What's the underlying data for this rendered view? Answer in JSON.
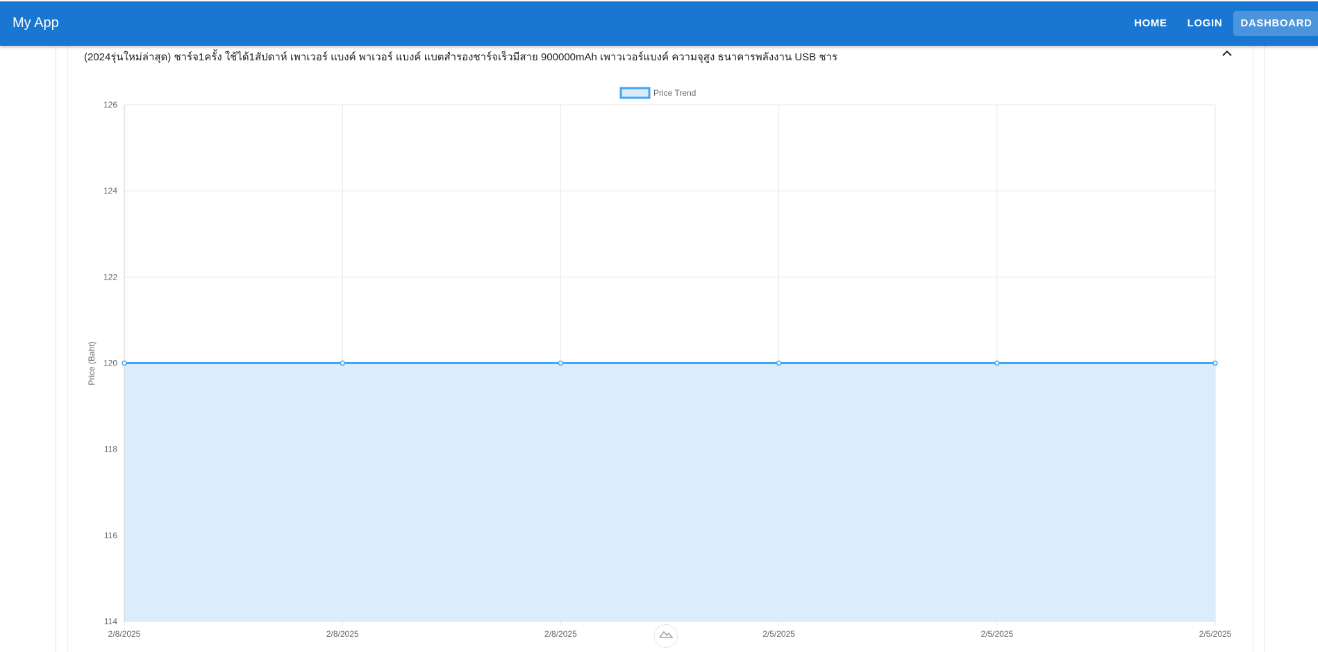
{
  "app": {
    "title": "My App"
  },
  "nav": {
    "home": "HOME",
    "login": "LOGIN",
    "dashboard": "DASHBOARD"
  },
  "panel": {
    "title": "(2024รุ่นใหม่ล่าสุด) ชาร์จ1ครั้ง ใช้ได้1สัปดาห์ เพาเวอร์ แบงค์ พาเวอร์ แบงค์ แบตสำรองชาร์จเร็วมีสาย 900000mAh เพาวเวอร์แบงค์ ความจุสูง ธนาคารพลังงาน USB ชาร",
    "expanded": true
  },
  "colors": {
    "appbar": "#1976d2",
    "line": "#42a5f5",
    "fill": "#dbecfa",
    "grid": "#e5e5e5"
  },
  "icons": {
    "collapse": "chevron-up-icon",
    "scroll": "mountain-logo-icon"
  },
  "chart_data": {
    "type": "area",
    "title": "",
    "xlabel": "",
    "ylabel": "Price (Baht)",
    "legend": {
      "label": "Price Trend",
      "position": "top-center"
    },
    "x": [
      "2/8/2025",
      "2/8/2025",
      "2/8/2025",
      "2/5/2025",
      "2/5/2025",
      "2/5/2025"
    ],
    "series": [
      {
        "name": "Price Trend",
        "values": [
          120,
          120,
          120,
          120,
          120,
          120
        ]
      }
    ],
    "ylim": [
      114,
      126
    ],
    "yticks": [
      114,
      116,
      118,
      120,
      122,
      124,
      126
    ],
    "grid": true
  }
}
